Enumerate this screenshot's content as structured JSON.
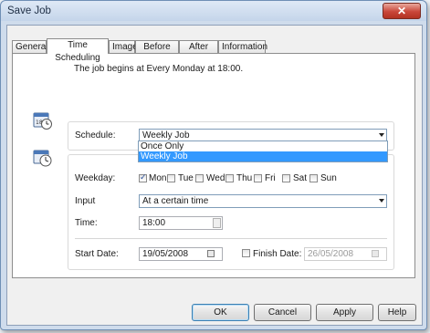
{
  "window": {
    "title": "Save Job",
    "close_glyph": "✕"
  },
  "tabs": [
    {
      "label": "General"
    },
    {
      "label": "Time Scheduling"
    },
    {
      "label": "Image"
    },
    {
      "label": "Before Job"
    },
    {
      "label": "After Job"
    },
    {
      "label": "Information"
    }
  ],
  "info_text": "The job begins at Every Monday at 18:00.",
  "schedule": {
    "label": "Schedule:",
    "selected": "Weekly Job",
    "options": [
      "Once Only",
      "Weekly Job"
    ]
  },
  "weekday": {
    "label": "Weekday:",
    "days": [
      {
        "label": "Mon",
        "checked": true
      },
      {
        "label": "Tue",
        "checked": false
      },
      {
        "label": "Wed",
        "checked": false
      },
      {
        "label": "Thu",
        "checked": false
      },
      {
        "label": "Fri",
        "checked": false
      },
      {
        "label": "Sat",
        "checked": false
      },
      {
        "label": "Sun",
        "checked": false
      }
    ]
  },
  "input": {
    "label": "Input",
    "selected": "At a certain time"
  },
  "time": {
    "label": "Time:",
    "value": "18:00"
  },
  "start_date": {
    "label": "Start Date:",
    "value": "19/05/2008"
  },
  "finish_date": {
    "label": "Finish Date:",
    "value": "26/05/2008",
    "checked": false
  },
  "buttons": {
    "ok": "OK",
    "cancel": "Cancel",
    "apply": "Apply",
    "help": "Help"
  },
  "icons": {
    "calendar": "calendar-clock-icon",
    "clock": "clock-icon"
  },
  "colors": {
    "selection": "#3399ff",
    "close": "#c9473a"
  }
}
